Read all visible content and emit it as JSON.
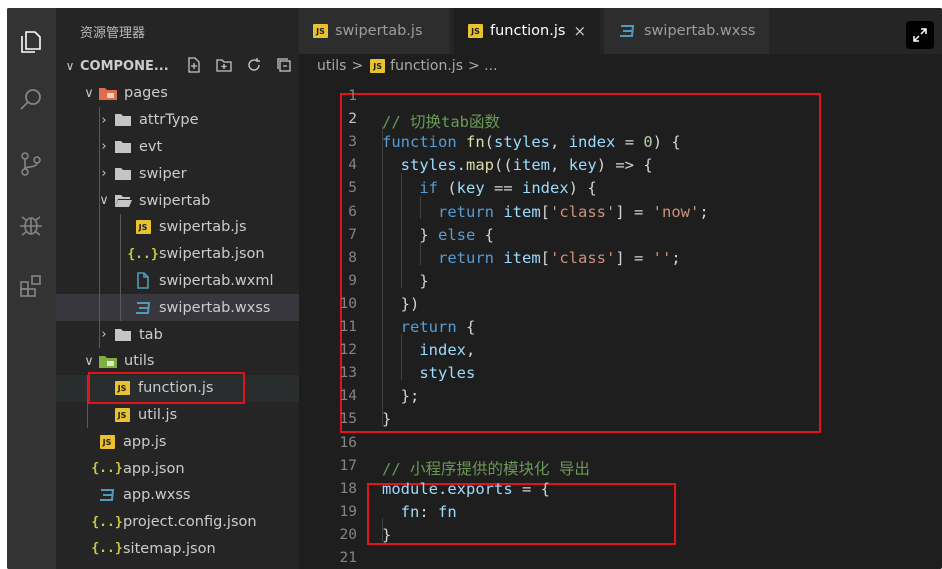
{
  "sidebar": {
    "title": "资源管理器",
    "section": "COMPONE...",
    "items": [
      {
        "label": "pages",
        "depth": 1,
        "type": "folder-pages",
        "open": true
      },
      {
        "label": "attrType",
        "depth": 2,
        "type": "folder",
        "open": false
      },
      {
        "label": "evt",
        "depth": 2,
        "type": "folder",
        "open": false
      },
      {
        "label": "swiper",
        "depth": 2,
        "type": "folder",
        "open": false
      },
      {
        "label": "swipertab",
        "depth": 2,
        "type": "folder",
        "open": true
      },
      {
        "label": "swipertab.js",
        "depth": 3,
        "type": "js"
      },
      {
        "label": "swipertab.json",
        "depth": 3,
        "type": "json"
      },
      {
        "label": "swipertab.wxml",
        "depth": 3,
        "type": "wxml"
      },
      {
        "label": "swipertab.wxss",
        "depth": 3,
        "type": "wxss"
      },
      {
        "label": "tab",
        "depth": 2,
        "type": "folder",
        "open": false
      },
      {
        "label": "utils",
        "depth": 1,
        "type": "folder-utils",
        "open": true
      },
      {
        "label": "function.js",
        "depth": 2,
        "type": "js",
        "selected": true
      },
      {
        "label": "util.js",
        "depth": 2,
        "type": "js"
      },
      {
        "label": "app.js",
        "depth": 1,
        "type": "js"
      },
      {
        "label": "app.json",
        "depth": 1,
        "type": "json"
      },
      {
        "label": "app.wxss",
        "depth": 1,
        "type": "wxss"
      },
      {
        "label": "project.config.json",
        "depth": 1,
        "type": "json"
      },
      {
        "label": "sitemap.json",
        "depth": 1,
        "type": "json"
      }
    ]
  },
  "tabs": [
    {
      "label": "swipertab.js",
      "type": "js",
      "active": false
    },
    {
      "label": "function.js",
      "type": "js",
      "active": true,
      "close": "×"
    },
    {
      "label": "swipertab.wxss",
      "type": "wxss",
      "active": false
    }
  ],
  "breadcrumb": {
    "folder": "utils",
    "sep": ">",
    "file": "function.js",
    "tail": "> ..."
  },
  "editor": {
    "line_numbers": [
      "1",
      "2",
      "3",
      "4",
      "5",
      "6",
      "7",
      "8",
      "9",
      "10",
      "11",
      "12",
      "13",
      "14",
      "15",
      "16",
      "17",
      "18",
      "19",
      "20",
      "21"
    ],
    "current_line": 2,
    "lines": [
      "",
      "  // 切换tab函数",
      "  function fn(styles, index = 0) {",
      "    styles.map((item, key) => {",
      "      if (key == index) {",
      "        return item['class'] = 'now';",
      "      } else {",
      "        return item['class'] = '';",
      "      }",
      "    })",
      "    return {",
      "      index,",
      "      styles",
      "    };",
      "  }",
      "",
      "  // 小程序提供的模块化 导出",
      "  module.exports = {",
      "    fn: fn",
      "  }",
      ""
    ]
  },
  "colors": {
    "accent": "#e0141b",
    "js": "#e8c230",
    "wxss": "#519aba",
    "folder": "#c09553"
  }
}
